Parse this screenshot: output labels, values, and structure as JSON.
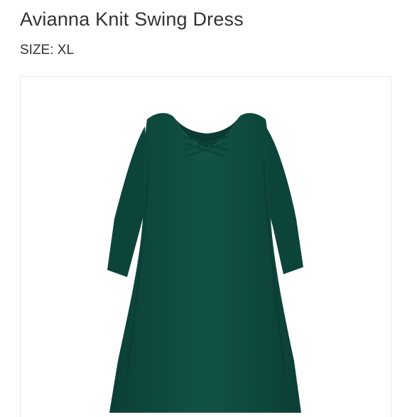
{
  "product": {
    "title": "Avianna Knit Swing Dress",
    "size_label": "SIZE:",
    "size_value": "XL",
    "image_subject": "dress-photo"
  },
  "colors": {
    "dress": "#0f4a3f",
    "dress_shadow": "#0a3a31",
    "text": "#333333",
    "card_border": "#ececec"
  }
}
